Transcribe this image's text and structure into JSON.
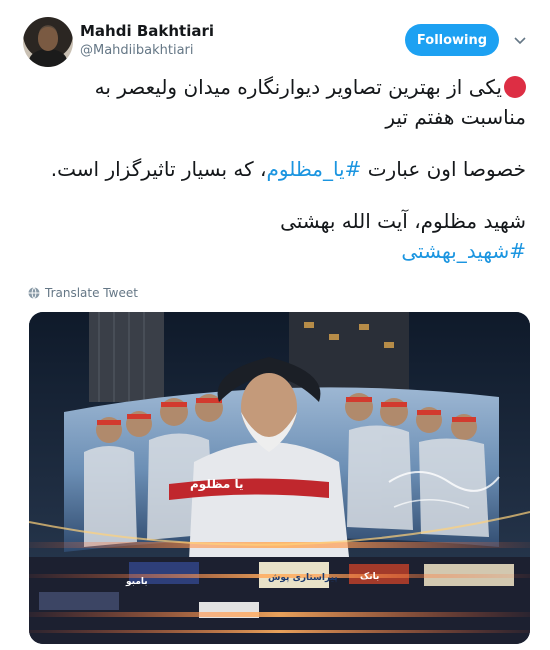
{
  "author": {
    "name": "Mahdi Bakhtiari",
    "handle": "@Mahdiibakhtiari"
  },
  "follow_button": {
    "label": "Following"
  },
  "icons": {
    "caret": "chevron-down-icon",
    "translate": "globe-icon",
    "status": "red-circle-emoji"
  },
  "tweet": {
    "line1": "یکی از بهترین تصاویر دیوارنگاره میدان ولیعصر به",
    "line2": "مناسبت هفتم تیر",
    "line3_before": "خصوصا اون عبارت ",
    "line3_hashtag": "#یا_مظلوم",
    "line3_after": "، که بسیار تاثیرگزار است.",
    "line4": "شهید مظلوم، آیت الله بهشتی",
    "hashtag2": "#شهید_بهشتی"
  },
  "translate_link": {
    "label": "Translate Tweet"
  },
  "photo": {
    "banner_text": "یا مظلوم",
    "shop_sign_1": "پیراستاری پوش",
    "shop_sign_2": "بامبو",
    "shop_sign_3": "بانک"
  },
  "colors": {
    "follow_bg": "#1da1f2",
    "hashtag": "#1b95e0",
    "muted": "#657786",
    "red_dot": "#dd2e44"
  }
}
